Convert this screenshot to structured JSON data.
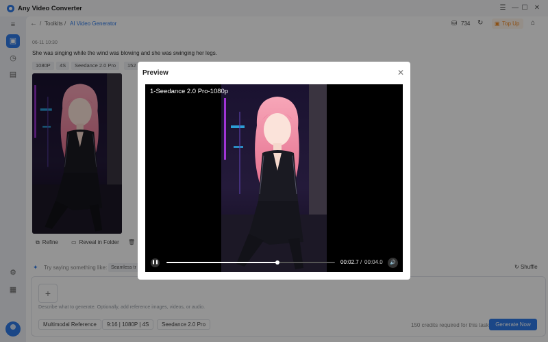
{
  "app": {
    "title": "Any Video Converter"
  },
  "window_controls": {
    "menu": "☰",
    "minimize": "—",
    "maximize": "☐",
    "close": "✕"
  },
  "breadcrumb": {
    "back": "←",
    "sep1": "/",
    "root": "Toolkits",
    "sep2": "/",
    "current": "AI Video Generator"
  },
  "header": {
    "credits": "734",
    "topup_label": "Top Up"
  },
  "result": {
    "timestamp": "06-11 10:30",
    "prompt": "She was singing while the wind was blowing and she was swinging her legs.",
    "tags": [
      "1080P",
      "4S",
      "Seedance 2.0 Pro",
      "152"
    ],
    "actions": {
      "refine": "Refine",
      "reveal": "Reveal in Folder"
    }
  },
  "suggestions": {
    "label": "Try saying something like:",
    "chip": "Seamless tr",
    "shuffle": "Shuffle"
  },
  "composer": {
    "placeholder": "Describe what to generate. Optionally, add reference images, videos, or audio.",
    "options": [
      "Multimodal Reference",
      "9:16 | 1080P | 4S",
      "Seedance 2.0 Pro"
    ],
    "credits_required": "150 credits required for this task",
    "generate_label": "Generate Now"
  },
  "preview": {
    "title": "Preview",
    "video_title": "1-Seedance 2.0 Pro-1080p",
    "current_time": "00:02.7",
    "time_separator": "/",
    "duration": "00:04.0",
    "progress": 0.66
  },
  "colors": {
    "accent": "#2f7be8",
    "topup": "#f08a24",
    "player_bg": "#000000"
  }
}
